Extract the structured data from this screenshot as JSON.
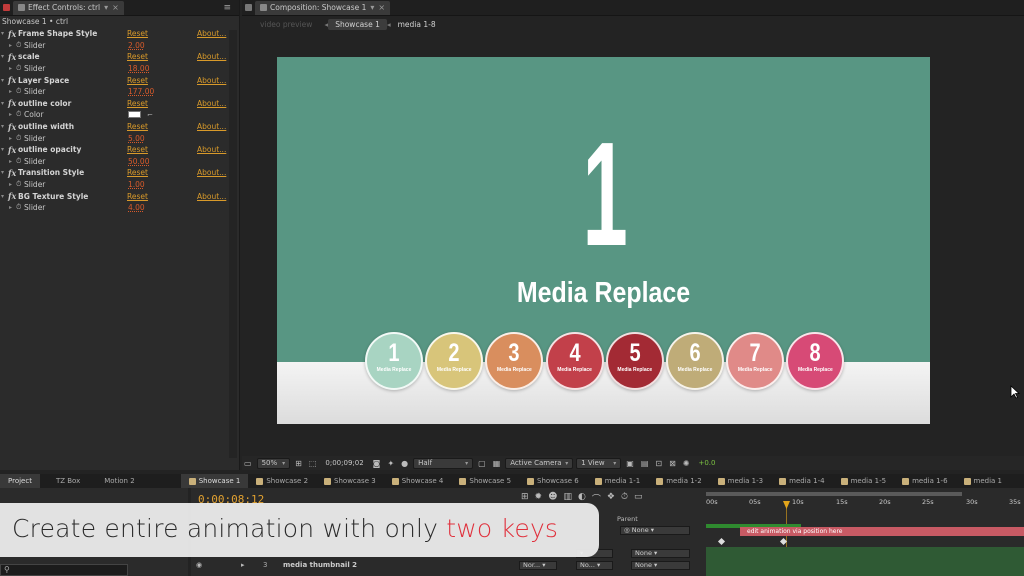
{
  "effects_panel": {
    "tab_label": "Effect Controls: ctrl",
    "layer_path": "Showcase 1 • ctrl",
    "reset_label": "Reset",
    "about_label": "About...",
    "effects": [
      {
        "name": "Frame Shape Style",
        "param": "Slider",
        "value": "2.00"
      },
      {
        "name": "scale",
        "param": "Slider",
        "value": "18.00"
      },
      {
        "name": "Layer Space",
        "param": "Slider",
        "value": "177.00"
      },
      {
        "name": "outline color",
        "param": "Color",
        "value": "",
        "color": "#ffffff"
      },
      {
        "name": "outline width",
        "param": "Slider",
        "value": "5.00"
      },
      {
        "name": "outline opacity",
        "param": "Slider",
        "value": "50.00"
      },
      {
        "name": "Transition Style",
        "param": "Slider",
        "value": "1.00"
      },
      {
        "name": "BG Texture Style",
        "param": "Slider",
        "value": "4.00"
      }
    ]
  },
  "composition_panel": {
    "tab_label": "Composition: Showcase 1",
    "muted_label": "video preview",
    "breadcrumb": [
      "Showcase 1",
      "media 1-8"
    ],
    "canvas": {
      "big_number": "1",
      "headline": "Media Replace",
      "bg_color": "#589683",
      "circles": [
        {
          "num": "1",
          "label": "Media Replace",
          "color": "#a8d4c2"
        },
        {
          "num": "2",
          "label": "Media Replace",
          "color": "#d8c57a"
        },
        {
          "num": "3",
          "label": "Media Replace",
          "color": "#d98e5e"
        },
        {
          "num": "4",
          "label": "Media Replace",
          "color": "#c2404a"
        },
        {
          "num": "5",
          "label": "Media Replace",
          "color": "#a32a34"
        },
        {
          "num": "6",
          "label": "Media Replace",
          "color": "#bfac78"
        },
        {
          "num": "7",
          "label": "Media Replace",
          "color": "#e08a88"
        },
        {
          "num": "8",
          "label": "Media Replace",
          "color": "#d74a76"
        }
      ]
    },
    "toolbar": {
      "zoom": "50%",
      "timecode": "0;00;09;02",
      "resolution": "Half",
      "camera": "Active Camera",
      "view": "1 View",
      "exposure": "+0.0"
    }
  },
  "bottom_tabs": {
    "left": [
      "Project",
      "TZ Box",
      "Motion 2"
    ],
    "comps": [
      "Showcase 1",
      "Showcase 2",
      "Showcase 3",
      "Showcase 4",
      "Showcase 5",
      "Showcase 6",
      "media 1-1",
      "media 1-2",
      "media 1-3",
      "media 1-4",
      "media 1-5",
      "media 1-6",
      "media 1"
    ]
  },
  "timeline": {
    "time": "0;00;08;12",
    "ruler": [
      "00s",
      "05s",
      "10s",
      "15s",
      "20s",
      "25s",
      "30s",
      "35s"
    ],
    "parent_header": "Parent",
    "parent_none": "None",
    "layer_number": "3",
    "layer_name": "media thumbnail 2",
    "mode_value": "Nor...",
    "trkmat_value": "No...",
    "bar_label": "edit animation via position here"
  },
  "caption": {
    "text": "Create entire animation with only ",
    "accent": "two keys",
    "accent_color": "#e0303c"
  }
}
